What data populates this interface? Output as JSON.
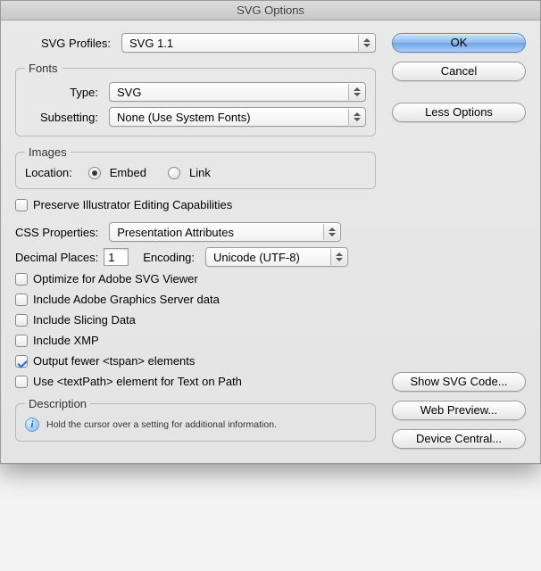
{
  "title": "SVG Options",
  "labels": {
    "svg_profiles": "SVG Profiles:",
    "fonts_group": "Fonts",
    "font_type": "Type:",
    "font_subsetting": "Subsetting:",
    "images_group": "Images",
    "image_location": "Location:",
    "embed": "Embed",
    "link": "Link",
    "preserve_ai": "Preserve Illustrator Editing Capabilities",
    "css_properties": "CSS Properties:",
    "decimal_places": "Decimal Places:",
    "encoding": "Encoding:",
    "optimize_asv": "Optimize for Adobe SVG Viewer",
    "include_ags": "Include Adobe Graphics Server data",
    "include_slicing": "Include Slicing Data",
    "include_xmp": "Include XMP",
    "output_tspan": "Output fewer <tspan> elements",
    "use_textpath": "Use <textPath> element for Text on Path",
    "description_group": "Description",
    "description_hint": "Hold the cursor over a setting for additional information."
  },
  "values": {
    "svg_profile": "SVG 1.1",
    "font_type": "SVG",
    "font_subsetting": "None (Use System Fonts)",
    "image_location": "embed",
    "preserve_ai": false,
    "css_properties": "Presentation Attributes",
    "decimal_places": "1",
    "encoding": "Unicode (UTF-8)",
    "optimize_asv": false,
    "include_ags": false,
    "include_slicing": false,
    "include_xmp": false,
    "output_tspan": true,
    "use_textpath": false
  },
  "buttons": {
    "ok": "OK",
    "cancel": "Cancel",
    "less_options": "Less Options",
    "show_svg_code": "Show SVG Code...",
    "web_preview": "Web Preview...",
    "device_central": "Device Central..."
  }
}
